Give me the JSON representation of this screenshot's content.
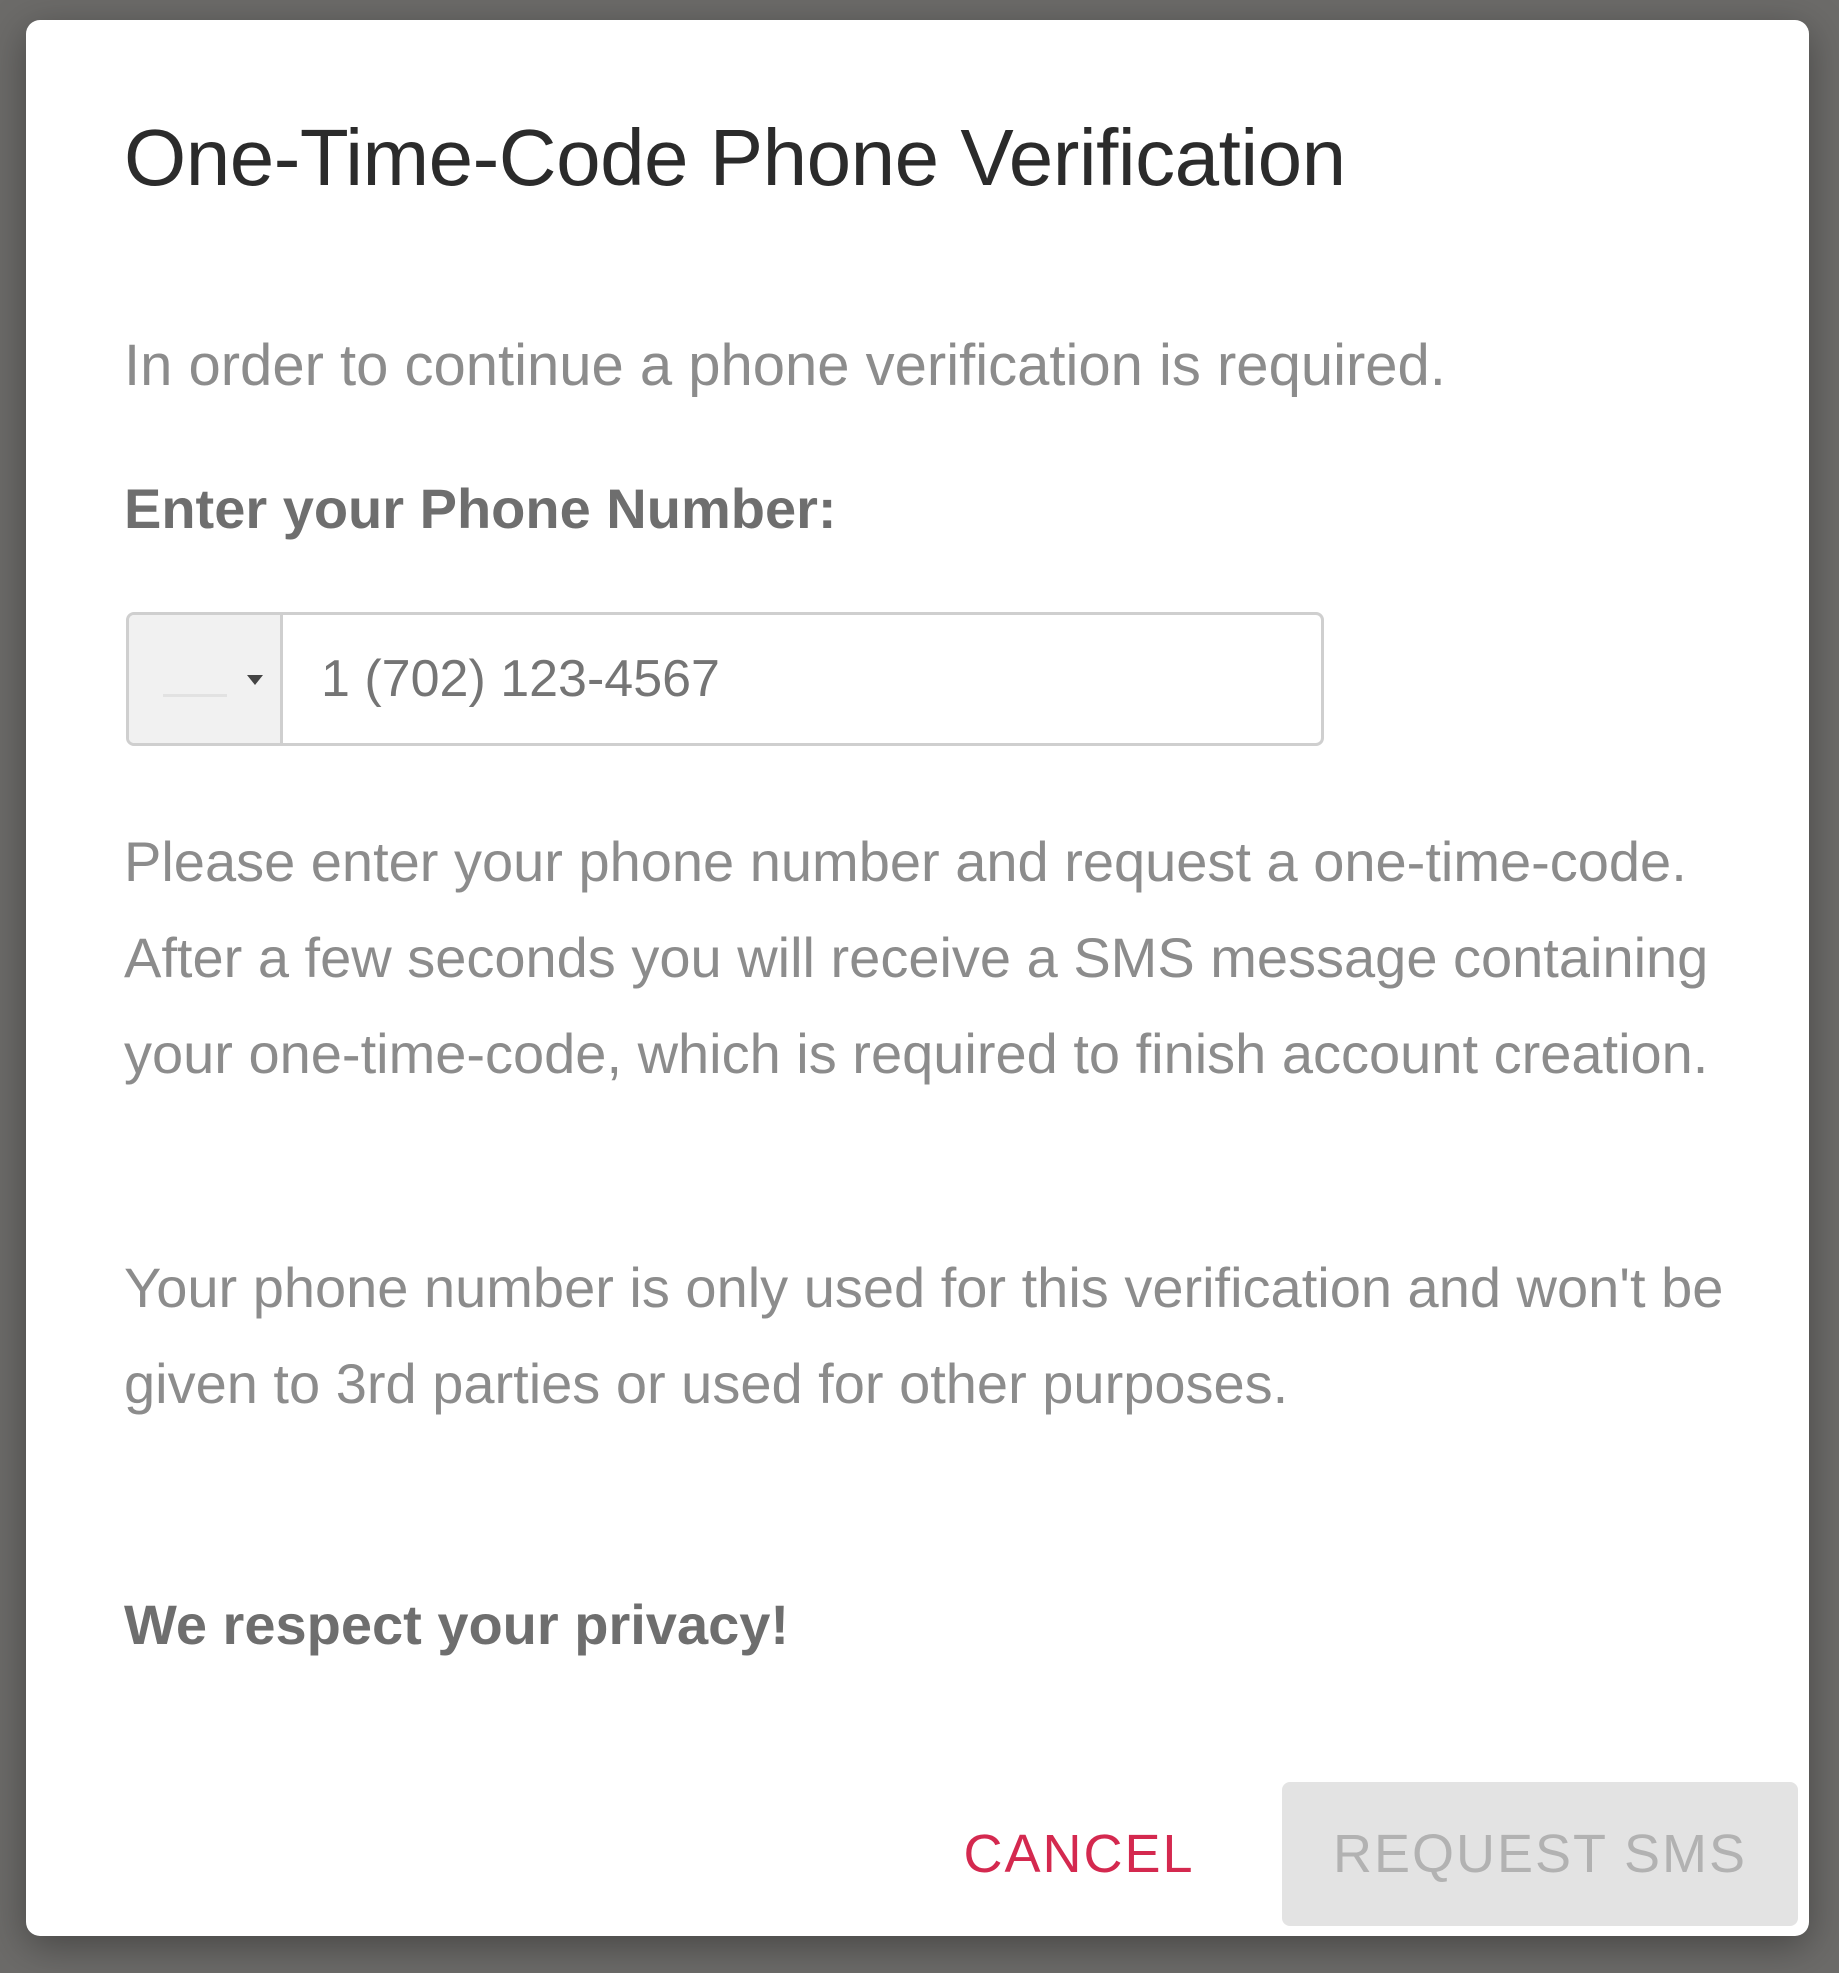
{
  "dialog": {
    "title": "One-Time-Code Phone Verification",
    "intro": "In order to continue a phone verification is required.",
    "phone_label": "Enter your Phone Number:",
    "phone_input": {
      "value": "",
      "placeholder": "1 (702) 123-4567"
    },
    "country_select": {
      "icon": "chevron-down-icon"
    },
    "paragraph_1": "Please enter your phone number and request a one-time-code. After a few seconds you will receive a SMS message containing your one-time-code, which is required to finish account creation.",
    "paragraph_2": "Your phone number is only used for this verification and won't be given to 3rd parties or used for other purposes.",
    "privacy_note": "We respect your privacy!",
    "actions": {
      "cancel_label": "CANCEL",
      "request_label": "REQUEST SMS"
    }
  },
  "colors": {
    "accent_cancel": "#d4294f",
    "disabled_button_bg": "#e3e3e3",
    "disabled_button_text": "#b2b2b2",
    "overlay": "#6c6b69"
  }
}
